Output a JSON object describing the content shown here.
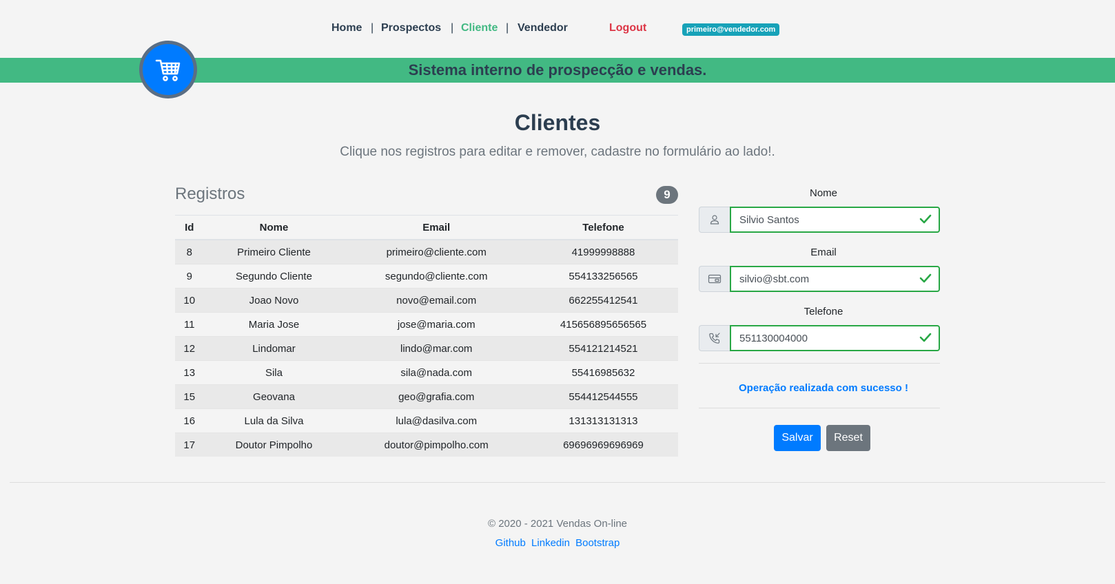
{
  "nav": {
    "home": "Home",
    "sep": "|",
    "prospectos": "Prospectos",
    "cliente": "Cliente",
    "vendedor": "Vendedor",
    "logout": "Logout",
    "user_email": "primeiro@vendedor.com"
  },
  "banner": {
    "text": "Sistema interno de prospecção e vendas.",
    "logo_icon": "shopping-cart-icon"
  },
  "page": {
    "title": "Clientes",
    "subtitle": "Clique nos registros para editar e remover, cadastre no formulário ao lado!."
  },
  "records": {
    "title": "Registros",
    "count": "9",
    "columns": [
      "Id",
      "Nome",
      "Email",
      "Telefone"
    ],
    "rows": [
      [
        "8",
        "Primeiro Cliente",
        "primeiro@cliente.com",
        "41999998888"
      ],
      [
        "9",
        "Segundo Cliente",
        "segundo@cliente.com",
        "554133256565"
      ],
      [
        "10",
        "Joao Novo",
        "novo@email.com",
        "662255412541"
      ],
      [
        "11",
        "Maria Jose",
        "jose@maria.com",
        "415656895656565"
      ],
      [
        "12",
        "Lindomar",
        "lindo@mar.com",
        "554121214521"
      ],
      [
        "13",
        "Sila",
        "sila@nada.com",
        "55416985632"
      ],
      [
        "15",
        "Geovana",
        "geo@grafia.com",
        "554412544555"
      ],
      [
        "16",
        "Lula da Silva",
        "lula@dasilva.com",
        "131313131313"
      ],
      [
        "17",
        "Doutor Pimpolho",
        "doutor@pimpolho.com",
        "69696969696969"
      ]
    ]
  },
  "form": {
    "nome_label": "Nome",
    "nome_value": "Silvio Santos",
    "email_label": "Email",
    "email_value": "silvio@sbt.com",
    "telefone_label": "Telefone",
    "telefone_value": "551130004000",
    "success_message": "Operação realizada com sucesso !",
    "save_label": "Salvar",
    "reset_label": "Reset"
  },
  "footer": {
    "copyright": "© 2020 - 2021 Vendas On-line",
    "links": [
      "Github",
      "Linkedin",
      "Bootstrap"
    ]
  },
  "colors": {
    "accent_green": "#42b983",
    "primary_blue": "#007bff",
    "danger_red": "#dc3545",
    "info_teal": "#17a2b8",
    "secondary_gray": "#6c757d"
  }
}
